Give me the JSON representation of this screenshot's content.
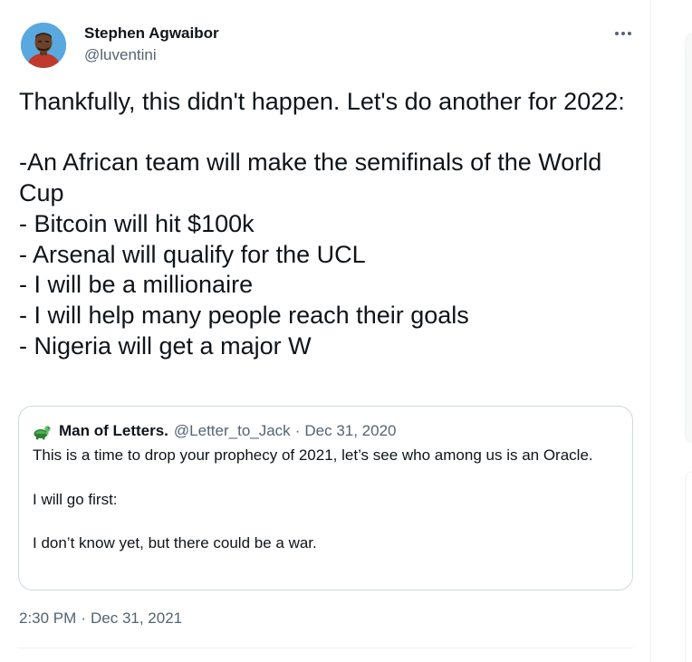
{
  "tweet": {
    "author": {
      "name": "Stephen Agwaibor",
      "handle": "@luventini"
    },
    "text": "Thankfully, this didn't happen. Let's do another for 2022:\n\n-An African team will make the semifinals of the World Cup\n- Bitcoin will hit $100k\n- Arsenal will qualify for the UCL\n- I will be a millionaire\n- I will help many people reach their goals\n- Nigeria will get a major W",
    "quoted": {
      "name": "Man of Letters.",
      "handle": "@Letter_to_Jack",
      "separator": "·",
      "date": "Dec 31, 2020",
      "text": "This is a time to drop your prophecy of 2021, let’s see who among us is an Oracle.\n\nI will go first:\n\nI don’t know yet, but there could be a war."
    },
    "time": "2:30 PM",
    "separator": "·",
    "date": "Dec 31, 2021"
  },
  "icons": {
    "more": "more-horizontal-icon",
    "avatar": "avatar",
    "quote_avatar": "turtle-avatar"
  },
  "colors": {
    "text": "#0f1419",
    "secondary": "#536471",
    "border": "#cfd9de",
    "divider": "#eff3f4"
  }
}
